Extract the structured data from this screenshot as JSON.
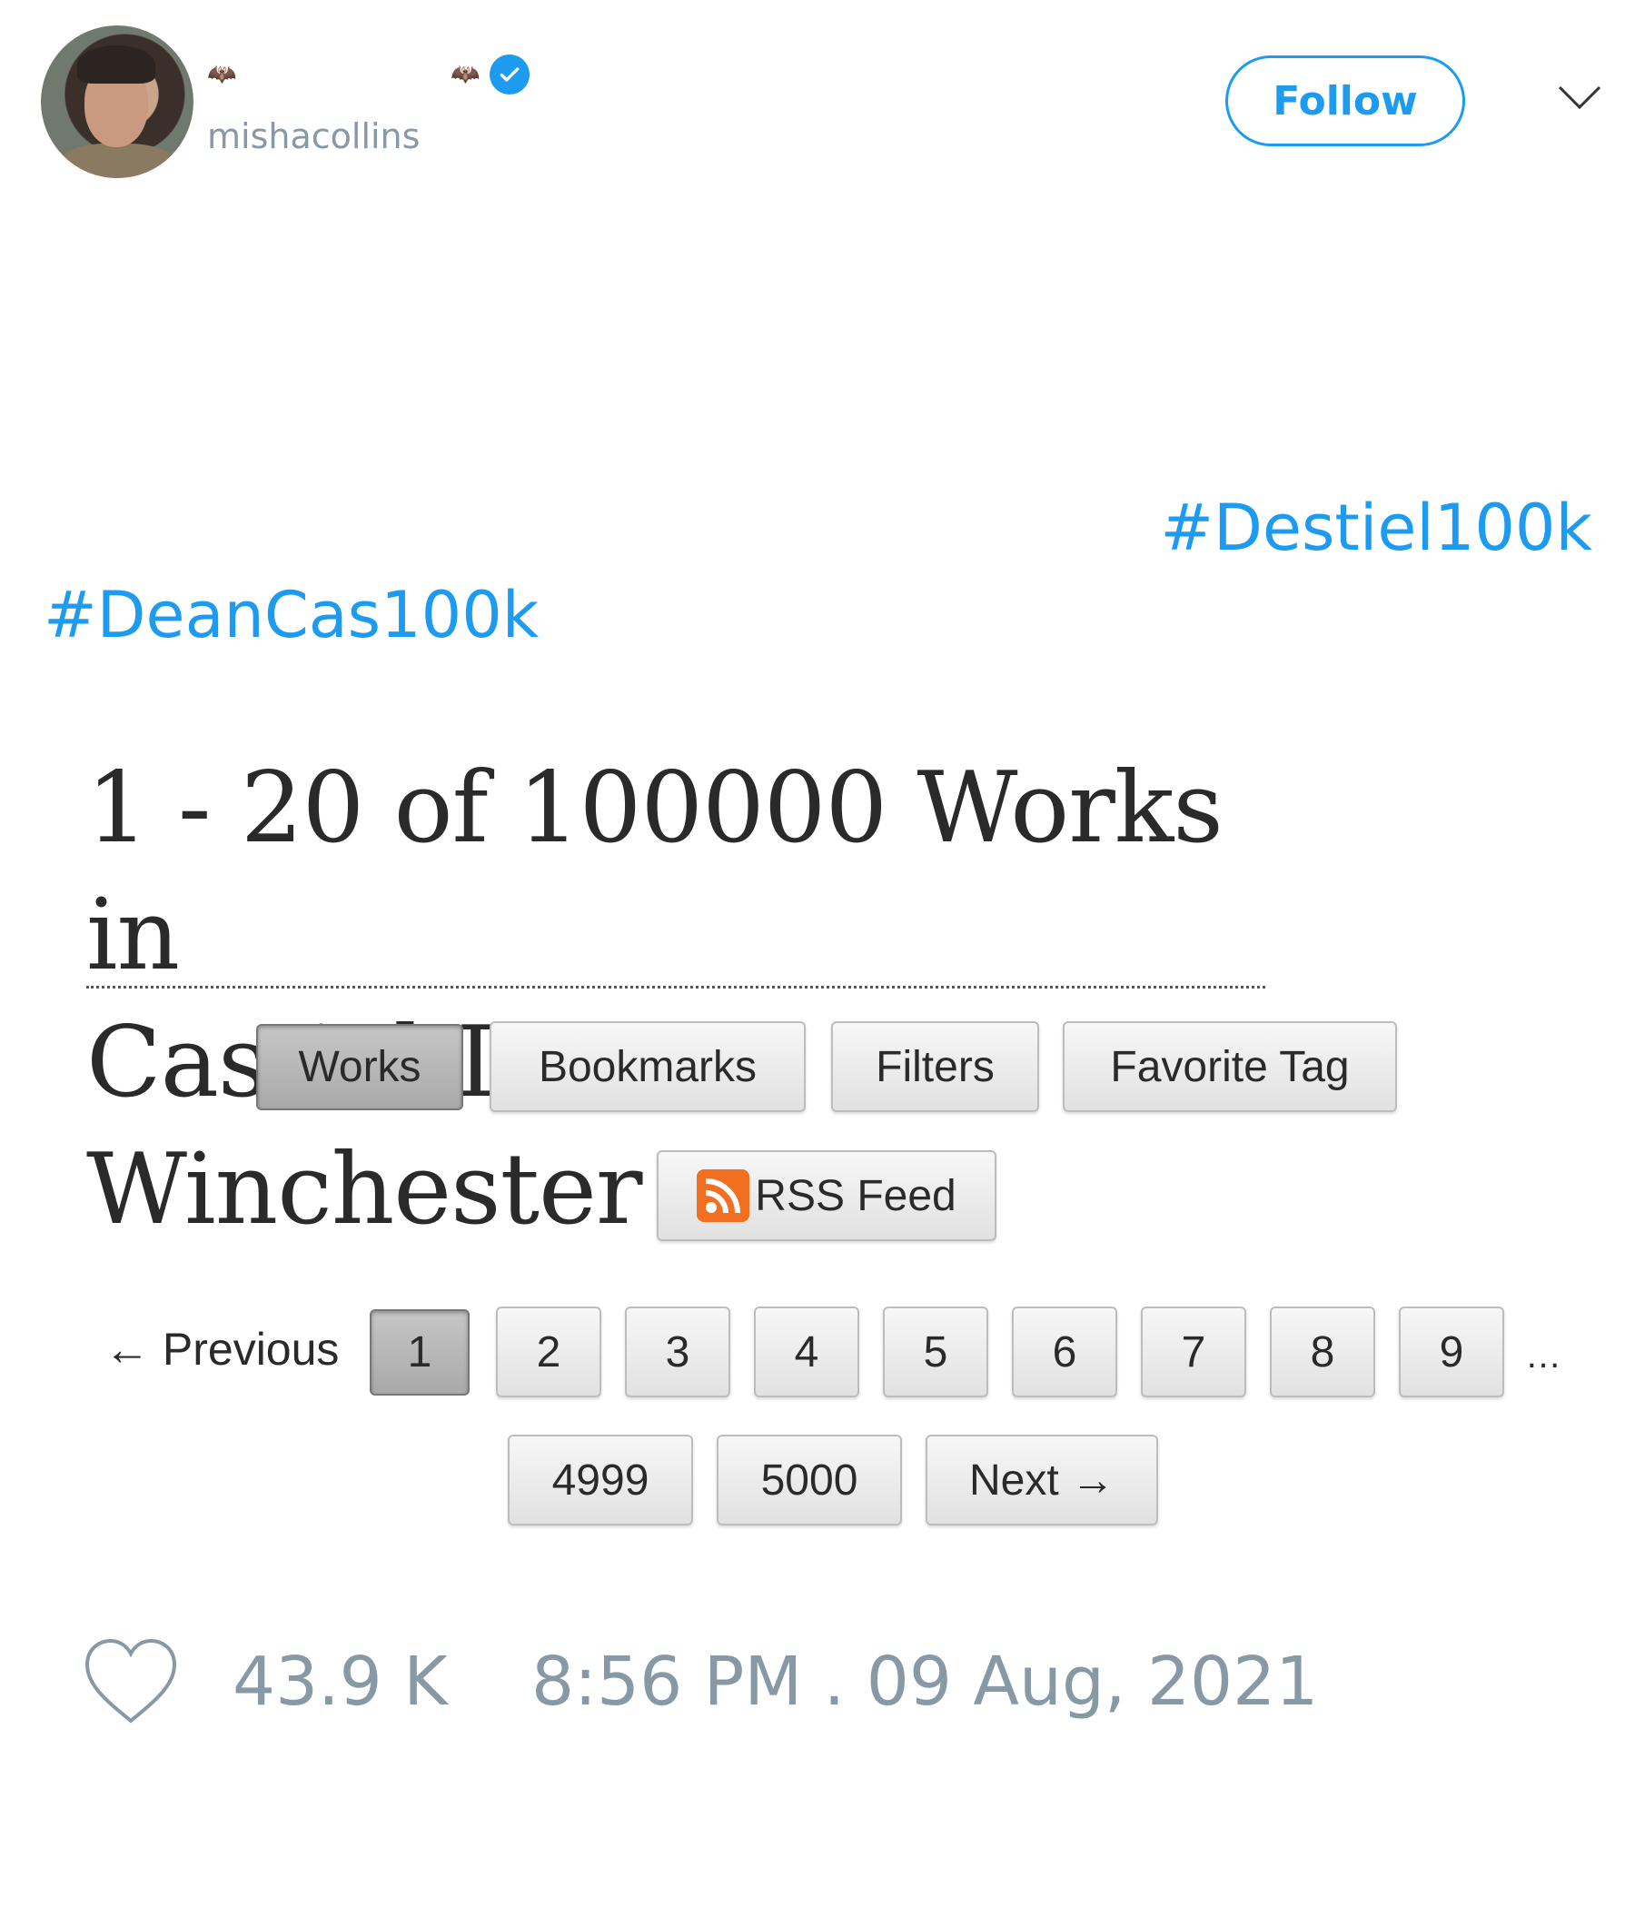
{
  "tweet": {
    "author": {
      "name_emoji_left": "🦇",
      "name_emoji_right": "🦇",
      "handle": "mishacollins",
      "verified": true
    },
    "follow_label": "Follow",
    "hashtags": [
      "#Destiel100k",
      "#DeanCas100k"
    ],
    "accent_color": "#1d9bf0",
    "likes": "43.9 K",
    "timestamp": "8:56 PM . 09 Aug, 2021"
  },
  "ao3": {
    "title_line1": "1 - 20 of 100000 Works in",
    "title_line2": "Castiel/Dean Winchester",
    "nav": [
      "Works",
      "Bookmarks",
      "Filters",
      "Favorite Tag"
    ],
    "active_nav": "Works",
    "rss_label": "RSS Feed",
    "pagination": {
      "previous": "← Previous",
      "pages": [
        "1",
        "2",
        "3",
        "4",
        "5",
        "6",
        "7",
        "8",
        "9"
      ],
      "current": "1",
      "ellipsis": "…",
      "last_pages": [
        "4999",
        "5000"
      ],
      "next": "Next →"
    }
  },
  "icons": [
    "avatar",
    "bat-emoji",
    "verified-badge",
    "chevron-down-icon",
    "rss-icon",
    "heart-icon"
  ]
}
